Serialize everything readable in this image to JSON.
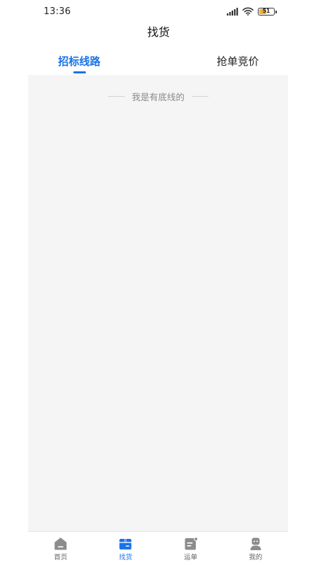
{
  "status_bar": {
    "time": "13:36",
    "battery_level": "51",
    "battery_fraction": 0.51,
    "icons": [
      "signal-icon",
      "wifi-icon",
      "battery-icon"
    ]
  },
  "header": {
    "title": "找货"
  },
  "tabs": [
    {
      "label": "招标线路",
      "active": true
    },
    {
      "label": "抢单竞价",
      "active": false
    }
  ],
  "content": {
    "end_notice": "我是有底线的"
  },
  "bottom_nav": {
    "items": [
      {
        "label": "首页",
        "icon": "home-icon",
        "active": false
      },
      {
        "label": "找货",
        "icon": "cargo-box-icon",
        "active": true
      },
      {
        "label": "运单",
        "icon": "waybill-icon",
        "active": false
      },
      {
        "label": "我的",
        "icon": "profile-icon",
        "active": false
      }
    ]
  },
  "colors": {
    "accent": "#1a73e8",
    "inactive_icon": "#8c8c8c",
    "content_bg": "#f5f5f5",
    "battery": "#f1b233"
  }
}
